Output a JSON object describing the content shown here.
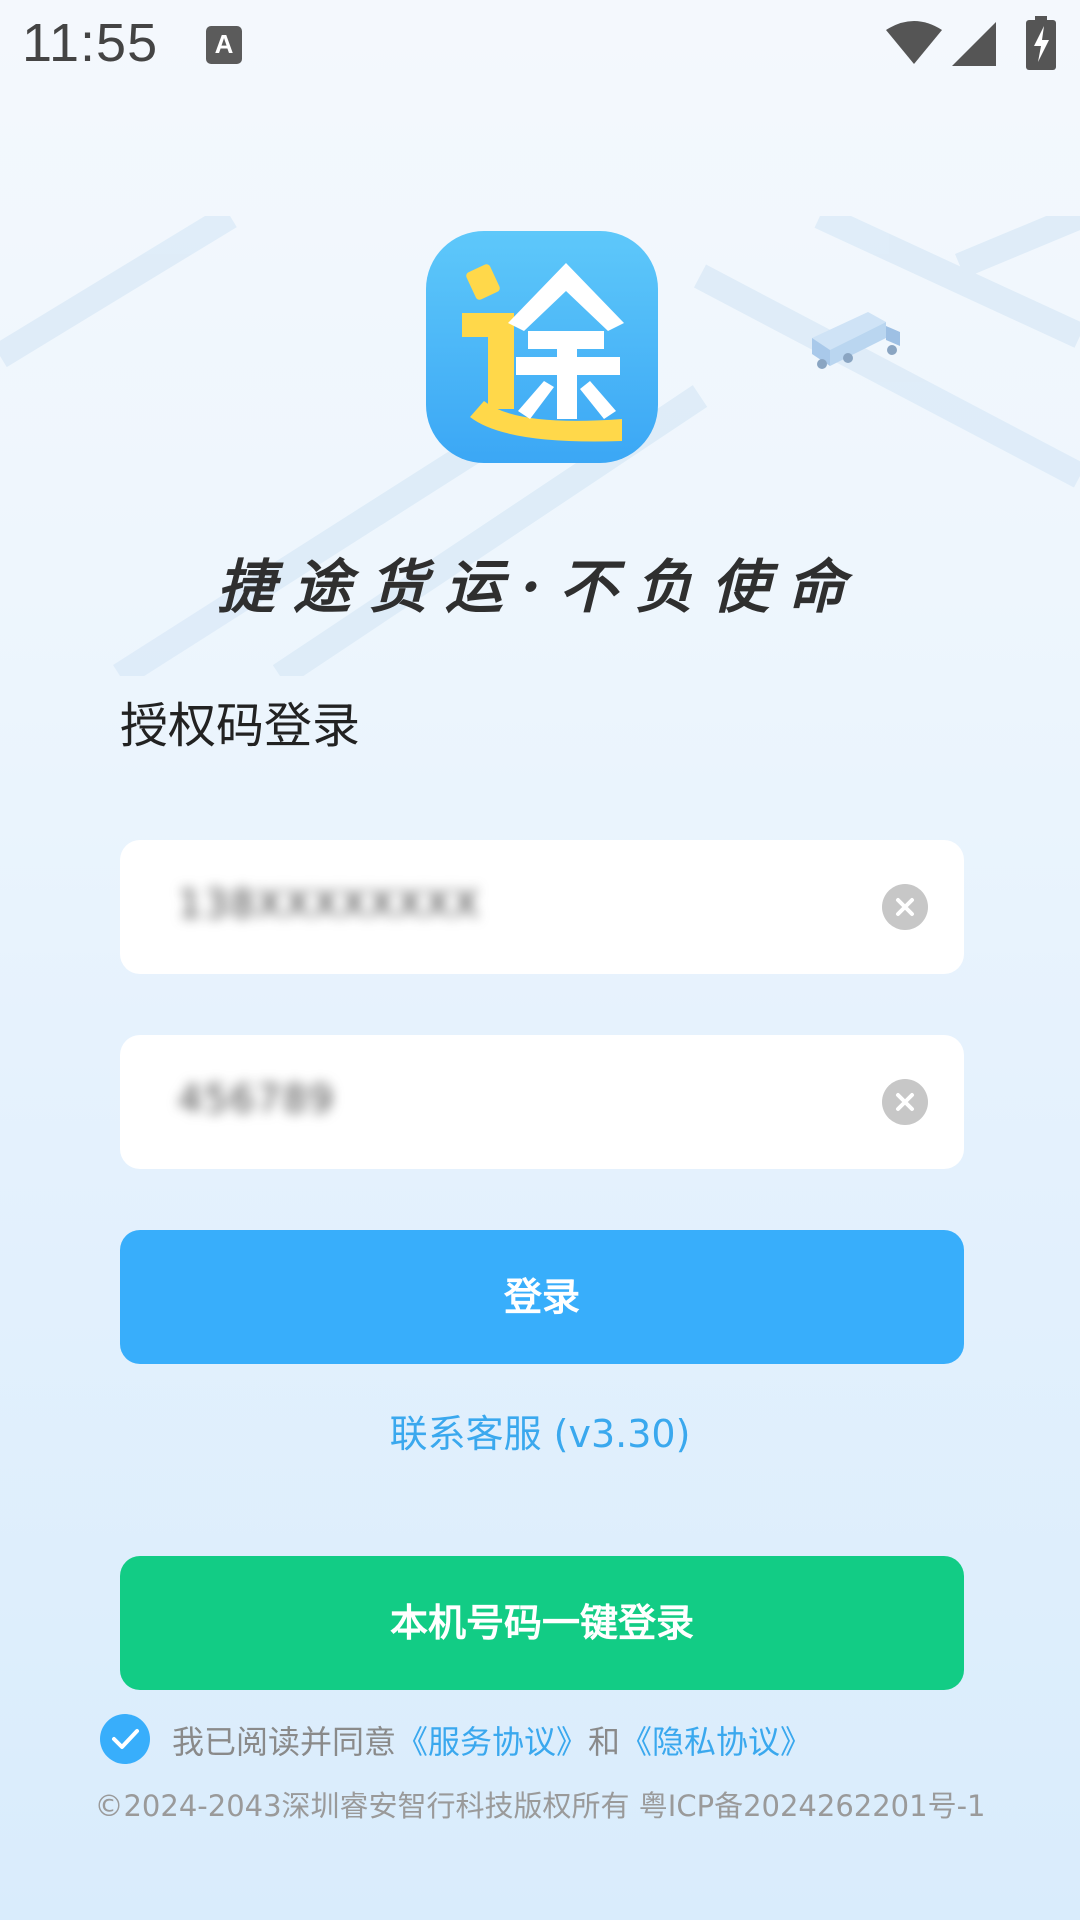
{
  "status_bar": {
    "time": "11:55",
    "notification_icon": "text-a-icon",
    "icons": [
      "wifi-icon",
      "signal-icon",
      "battery-charging-icon"
    ]
  },
  "branding": {
    "logo_char": "途",
    "logo_colors": {
      "background": "#3ba7f5",
      "character": "#ffd84a"
    },
    "slogan": "捷途货运·不负使命"
  },
  "form": {
    "title": "授权码登录",
    "account_value": "138XXXXXXXX",
    "code_value": "456789",
    "login_label": "登录",
    "contact_label": "联系客服",
    "version": "(v3.30)"
  },
  "onekey": {
    "label": "本机号码一键登录"
  },
  "agreement": {
    "checked": true,
    "prefix": "我已阅读并同意",
    "service_link": "《服务协议》",
    "and": "和",
    "privacy_link": "《隐私协议》"
  },
  "footer": {
    "copyright": "©2024-2043深圳睿安智行科技版权所有 粤ICP备2024262201号-1"
  },
  "colors": {
    "primary_blue": "#38aefb",
    "green": "#12cc85",
    "link_blue": "#3aa8ee"
  }
}
